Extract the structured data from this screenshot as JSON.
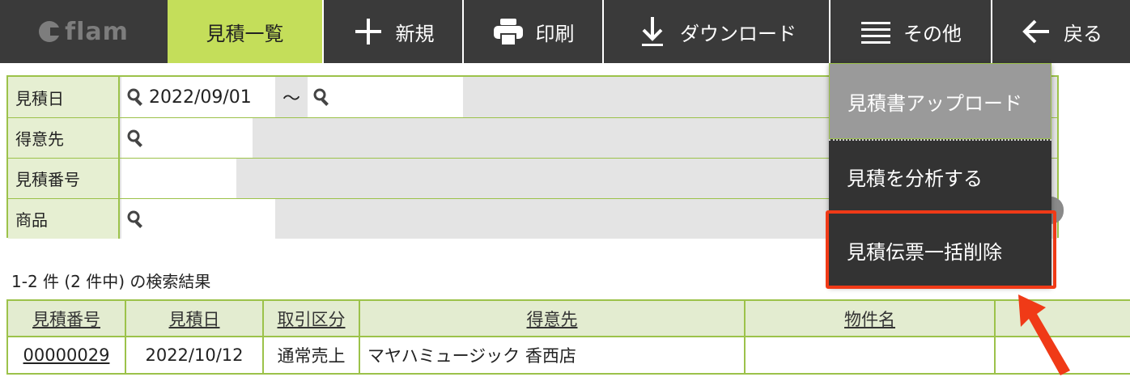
{
  "nav": {
    "logo_text": "flam",
    "items": [
      {
        "label": "見積一覧",
        "icon": null
      },
      {
        "label": "新規",
        "icon": "plus-icon"
      },
      {
        "label": "印刷",
        "icon": "printer-icon"
      },
      {
        "label": "ダウンロード",
        "icon": "download-icon"
      },
      {
        "label": "その他",
        "icon": "menu-icon"
      },
      {
        "label": "戻る",
        "icon": "back-arrow-icon"
      }
    ]
  },
  "search": {
    "rows": [
      {
        "label": "見積日",
        "from": "2022/09/01",
        "separator": "〜",
        "to": ""
      },
      {
        "label": "得意先",
        "value": ""
      },
      {
        "label": "見積番号",
        "value": ""
      },
      {
        "label": "商品",
        "value": ""
      }
    ]
  },
  "dropdown": {
    "items": [
      {
        "label": "見積書アップロード"
      },
      {
        "label": "見積を分析する"
      },
      {
        "label": "見積伝票一括削除"
      }
    ]
  },
  "results": {
    "summary": "1-2 件 (2 件中) の検索結果"
  },
  "table": {
    "headers": [
      "見積番号",
      "見積日",
      "取引区分",
      "得意先",
      "物件名",
      ""
    ],
    "rows": [
      [
        "00000029",
        "2022/10/12",
        "通常売上",
        "マヤハミュージック 香西店",
        "",
        ""
      ]
    ]
  },
  "colors": {
    "nav_bg": "#3a3a3a",
    "active_tab": "#c4de5a",
    "border_green": "#9cc24a",
    "highlight_red": "#f03a17"
  }
}
